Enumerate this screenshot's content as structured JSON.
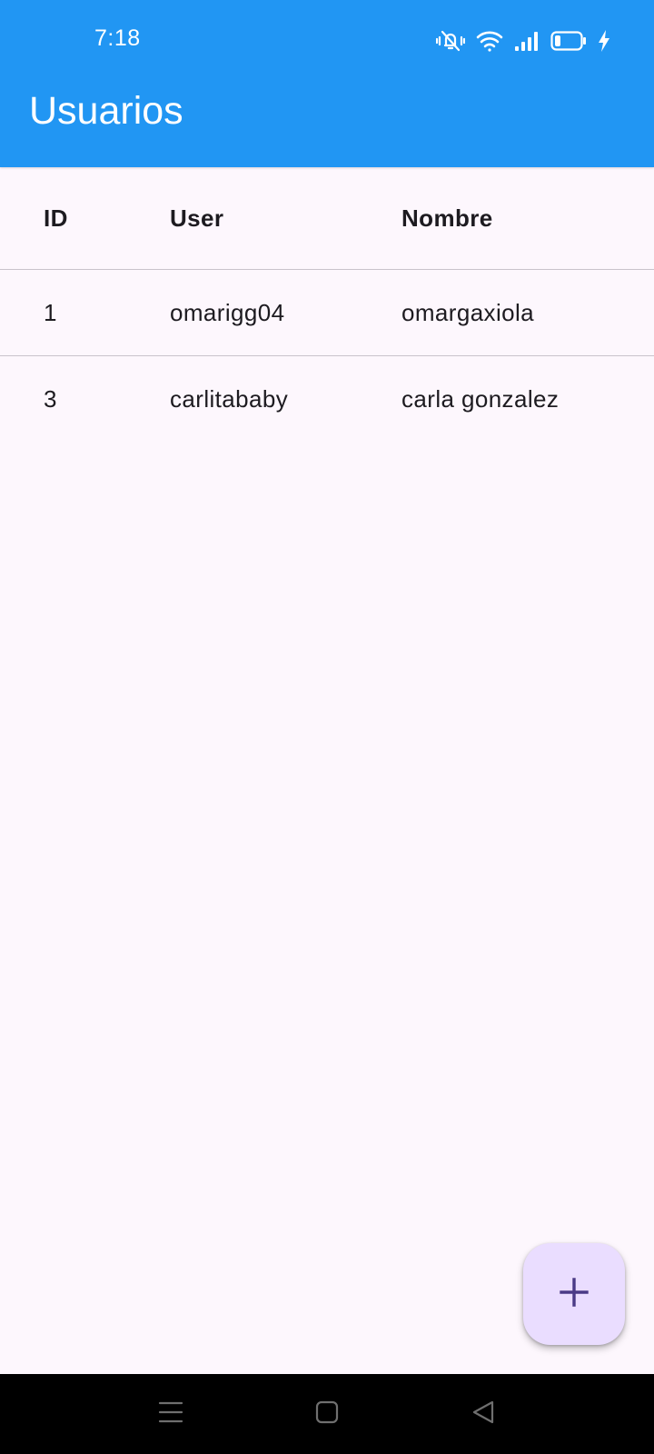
{
  "status_bar": {
    "time": "7:18",
    "icons": [
      "vibrate-silent-icon",
      "wifi-icon",
      "signal-icon",
      "battery-icon",
      "charging-icon"
    ]
  },
  "app_bar": {
    "title": "Usuarios",
    "color": "#2196f3"
  },
  "table": {
    "columns": [
      "ID",
      "User",
      "Nombre"
    ],
    "rows": [
      [
        "1",
        "omarigg04",
        "omargaxiola"
      ],
      [
        "3",
        "carlitababy",
        "carla gonzalez"
      ]
    ]
  },
  "fab": {
    "icon": "plus-icon",
    "color": "#eaddff",
    "icon_color": "#4a3a86"
  },
  "nav_bar": {
    "buttons": [
      "menu-icon",
      "home-icon",
      "back-icon"
    ]
  }
}
